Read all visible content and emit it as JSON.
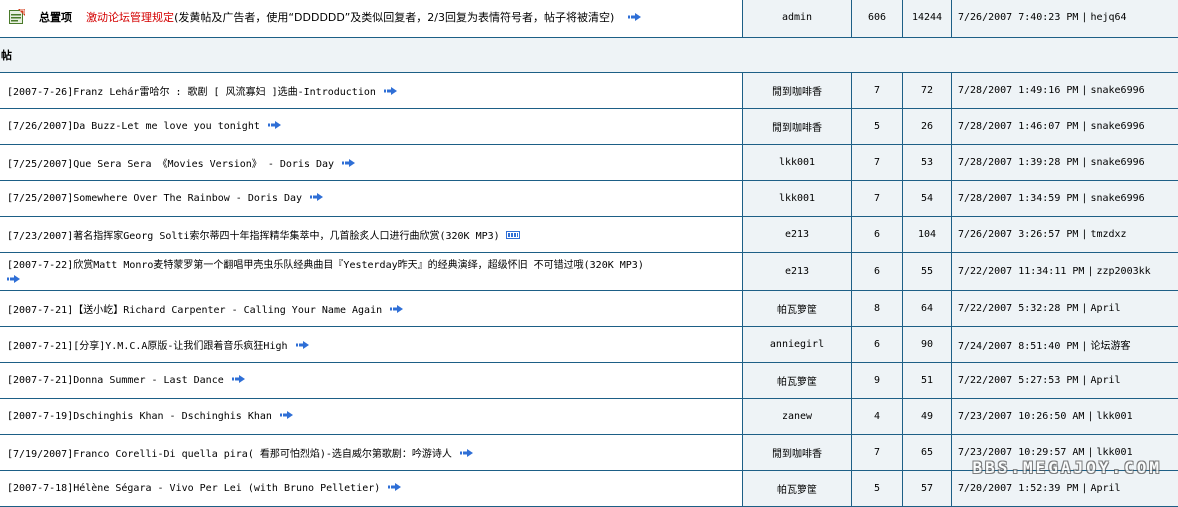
{
  "pinned": {
    "label": "总置项",
    "link": "激动论坛管理规定",
    "note": "(发黄帖及广告者，使用“DDDDDD”及类似回复者，2/3回复为表情符号者，帖子将被清空)",
    "author": "admin",
    "replies": "606",
    "views": "14244",
    "last_time": "7/26/2007 7:40:23 PM",
    "last_user": "hejq64"
  },
  "section": {
    "label": "帖"
  },
  "threads": [
    {
      "title": "[2007-7-26]Franz Lehár雷哈尔 : 歌剧 [ 风流寡妇 ]选曲-Introduction",
      "author": "閒到咖啡香",
      "replies": "7",
      "views": "72",
      "last_time": "7/28/2007 1:49:16 PM",
      "last_user": "snake6996"
    },
    {
      "title": "[7/26/2007]Da Buzz-Let me love you tonight",
      "author": "閒到咖啡香",
      "replies": "5",
      "views": "26",
      "last_time": "7/28/2007 1:46:07 PM",
      "last_user": "snake6996"
    },
    {
      "title": "[7/25/2007]Que Sera Sera 《Movies Version》 - Doris Day",
      "author": "lkk001",
      "replies": "7",
      "views": "53",
      "last_time": "7/28/2007 1:39:28 PM",
      "last_user": "snake6996"
    },
    {
      "title": "[7/25/2007]Somewhere Over The Rainbow - Doris Day",
      "author": "lkk001",
      "replies": "7",
      "views": "54",
      "last_time": "7/28/2007 1:34:59 PM",
      "last_user": "snake6996"
    },
    {
      "title": "[7/23/2007]著名指挥家Georg Solti索尔蒂四十年指挥精华集萃中，几首脍炙人口进行曲欣赏(320K MP3)",
      "author": "e213",
      "replies": "6",
      "views": "104",
      "last_time": "7/26/2007 3:26:57 PM",
      "last_user": "tmzdxz"
    },
    {
      "title": "[2007-7-22]欣赏Matt Monro麦特蒙罗第一个翻唱甲壳虫乐队经典曲目『Yesterday昨天』的经典演绎，超级怀旧 不可错过哦(320K MP3)",
      "author": "e213",
      "replies": "6",
      "views": "55",
      "last_time": "7/22/2007 11:34:11 PM",
      "last_user": "zzp2003kk"
    },
    {
      "title": "[2007-7-21]【送小屹】Richard Carpenter - Calling Your Name Again",
      "author": "帕瓦箩筐",
      "replies": "8",
      "views": "64",
      "last_time": "7/22/2007 5:32:28 PM",
      "last_user": "April"
    },
    {
      "title": "[2007-7-21][分享]Y.M.C.A原版-让我们跟着音乐疯狂High",
      "author": "anniegirl",
      "replies": "6",
      "views": "90",
      "last_time": "7/24/2007 8:51:40 PM",
      "last_user": "论坛游客"
    },
    {
      "title": "[2007-7-21]Donna Summer -  Last Dance",
      "author": "帕瓦箩筐",
      "replies": "9",
      "views": "51",
      "last_time": "7/22/2007 5:27:53 PM",
      "last_user": "April"
    },
    {
      "title": "[2007-7-19]Dschinghis Khan - Dschinghis Khan",
      "author": "zanew",
      "replies": "4",
      "views": "49",
      "last_time": "7/23/2007 10:26:50 AM",
      "last_user": "lkk001"
    },
    {
      "title": "[7/19/2007]Franco Corelli-Di quella pira( 看那可怕烈焰)-选自威尔第歌剧：吟游诗人",
      "author": "閒到咖啡香",
      "replies": "7",
      "views": "65",
      "last_time": "7/23/2007 10:29:57 AM",
      "last_user": "lkk001"
    },
    {
      "title": "[2007-7-18]Hélène Ségara - Vivo Per Lei (with Bruno Pelletier)",
      "author": "帕瓦箩筐",
      "replies": "5",
      "views": "57",
      "last_time": "7/20/2007 1:52:39 PM",
      "last_user": "April"
    }
  ],
  "watermark": "BBS.MEGAJOY.COM",
  "icons": {
    "pin": "announcement-icon",
    "arrow": "go-to-last-post-icon",
    "new": "new-post-icon"
  },
  "colors": {
    "border": "#1d5f86",
    "cell_bg": "#eef3f6",
    "pin_link": "#d40000",
    "arrow": "#2f6fd6"
  }
}
